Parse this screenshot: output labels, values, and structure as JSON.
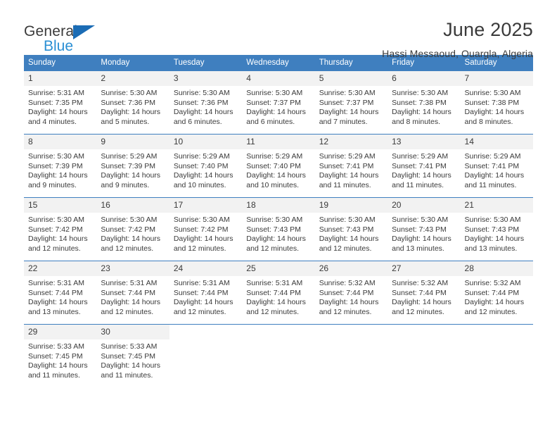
{
  "brand": {
    "line1": "General",
    "line2": "Blue",
    "triangle_color": "#1b6cb5",
    "line2_color": "#2a8fd4"
  },
  "header": {
    "title": "June 2025",
    "subtitle": "Hassi Messaoud, Ouargla, Algeria"
  },
  "colors": {
    "header_band": "#3f7fbf",
    "daynum_band": "#f2f2f2",
    "text": "#3a3a3a"
  },
  "weekdays": [
    "Sunday",
    "Monday",
    "Tuesday",
    "Wednesday",
    "Thursday",
    "Friday",
    "Saturday"
  ],
  "weeks": [
    [
      {
        "day": "1",
        "sunrise": "Sunrise: 5:31 AM",
        "sunset": "Sunset: 7:35 PM",
        "daylight": "Daylight: 14 hours and 4 minutes."
      },
      {
        "day": "2",
        "sunrise": "Sunrise: 5:30 AM",
        "sunset": "Sunset: 7:36 PM",
        "daylight": "Daylight: 14 hours and 5 minutes."
      },
      {
        "day": "3",
        "sunrise": "Sunrise: 5:30 AM",
        "sunset": "Sunset: 7:36 PM",
        "daylight": "Daylight: 14 hours and 6 minutes."
      },
      {
        "day": "4",
        "sunrise": "Sunrise: 5:30 AM",
        "sunset": "Sunset: 7:37 PM",
        "daylight": "Daylight: 14 hours and 6 minutes."
      },
      {
        "day": "5",
        "sunrise": "Sunrise: 5:30 AM",
        "sunset": "Sunset: 7:37 PM",
        "daylight": "Daylight: 14 hours and 7 minutes."
      },
      {
        "day": "6",
        "sunrise": "Sunrise: 5:30 AM",
        "sunset": "Sunset: 7:38 PM",
        "daylight": "Daylight: 14 hours and 8 minutes."
      },
      {
        "day": "7",
        "sunrise": "Sunrise: 5:30 AM",
        "sunset": "Sunset: 7:38 PM",
        "daylight": "Daylight: 14 hours and 8 minutes."
      }
    ],
    [
      {
        "day": "8",
        "sunrise": "Sunrise: 5:30 AM",
        "sunset": "Sunset: 7:39 PM",
        "daylight": "Daylight: 14 hours and 9 minutes."
      },
      {
        "day": "9",
        "sunrise": "Sunrise: 5:29 AM",
        "sunset": "Sunset: 7:39 PM",
        "daylight": "Daylight: 14 hours and 9 minutes."
      },
      {
        "day": "10",
        "sunrise": "Sunrise: 5:29 AM",
        "sunset": "Sunset: 7:40 PM",
        "daylight": "Daylight: 14 hours and 10 minutes."
      },
      {
        "day": "11",
        "sunrise": "Sunrise: 5:29 AM",
        "sunset": "Sunset: 7:40 PM",
        "daylight": "Daylight: 14 hours and 10 minutes."
      },
      {
        "day": "12",
        "sunrise": "Sunrise: 5:29 AM",
        "sunset": "Sunset: 7:41 PM",
        "daylight": "Daylight: 14 hours and 11 minutes."
      },
      {
        "day": "13",
        "sunrise": "Sunrise: 5:29 AM",
        "sunset": "Sunset: 7:41 PM",
        "daylight": "Daylight: 14 hours and 11 minutes."
      },
      {
        "day": "14",
        "sunrise": "Sunrise: 5:29 AM",
        "sunset": "Sunset: 7:41 PM",
        "daylight": "Daylight: 14 hours and 11 minutes."
      }
    ],
    [
      {
        "day": "15",
        "sunrise": "Sunrise: 5:30 AM",
        "sunset": "Sunset: 7:42 PM",
        "daylight": "Daylight: 14 hours and 12 minutes."
      },
      {
        "day": "16",
        "sunrise": "Sunrise: 5:30 AM",
        "sunset": "Sunset: 7:42 PM",
        "daylight": "Daylight: 14 hours and 12 minutes."
      },
      {
        "day": "17",
        "sunrise": "Sunrise: 5:30 AM",
        "sunset": "Sunset: 7:42 PM",
        "daylight": "Daylight: 14 hours and 12 minutes."
      },
      {
        "day": "18",
        "sunrise": "Sunrise: 5:30 AM",
        "sunset": "Sunset: 7:43 PM",
        "daylight": "Daylight: 14 hours and 12 minutes."
      },
      {
        "day": "19",
        "sunrise": "Sunrise: 5:30 AM",
        "sunset": "Sunset: 7:43 PM",
        "daylight": "Daylight: 14 hours and 12 minutes."
      },
      {
        "day": "20",
        "sunrise": "Sunrise: 5:30 AM",
        "sunset": "Sunset: 7:43 PM",
        "daylight": "Daylight: 14 hours and 13 minutes."
      },
      {
        "day": "21",
        "sunrise": "Sunrise: 5:30 AM",
        "sunset": "Sunset: 7:43 PM",
        "daylight": "Daylight: 14 hours and 13 minutes."
      }
    ],
    [
      {
        "day": "22",
        "sunrise": "Sunrise: 5:31 AM",
        "sunset": "Sunset: 7:44 PM",
        "daylight": "Daylight: 14 hours and 13 minutes."
      },
      {
        "day": "23",
        "sunrise": "Sunrise: 5:31 AM",
        "sunset": "Sunset: 7:44 PM",
        "daylight": "Daylight: 14 hours and 12 minutes."
      },
      {
        "day": "24",
        "sunrise": "Sunrise: 5:31 AM",
        "sunset": "Sunset: 7:44 PM",
        "daylight": "Daylight: 14 hours and 12 minutes."
      },
      {
        "day": "25",
        "sunrise": "Sunrise: 5:31 AM",
        "sunset": "Sunset: 7:44 PM",
        "daylight": "Daylight: 14 hours and 12 minutes."
      },
      {
        "day": "26",
        "sunrise": "Sunrise: 5:32 AM",
        "sunset": "Sunset: 7:44 PM",
        "daylight": "Daylight: 14 hours and 12 minutes."
      },
      {
        "day": "27",
        "sunrise": "Sunrise: 5:32 AM",
        "sunset": "Sunset: 7:44 PM",
        "daylight": "Daylight: 14 hours and 12 minutes."
      },
      {
        "day": "28",
        "sunrise": "Sunrise: 5:32 AM",
        "sunset": "Sunset: 7:44 PM",
        "daylight": "Daylight: 14 hours and 12 minutes."
      }
    ],
    [
      {
        "day": "29",
        "sunrise": "Sunrise: 5:33 AM",
        "sunset": "Sunset: 7:45 PM",
        "daylight": "Daylight: 14 hours and 11 minutes."
      },
      {
        "day": "30",
        "sunrise": "Sunrise: 5:33 AM",
        "sunset": "Sunset: 7:45 PM",
        "daylight": "Daylight: 14 hours and 11 minutes."
      },
      {
        "day": "",
        "sunrise": "",
        "sunset": "",
        "daylight": ""
      },
      {
        "day": "",
        "sunrise": "",
        "sunset": "",
        "daylight": ""
      },
      {
        "day": "",
        "sunrise": "",
        "sunset": "",
        "daylight": ""
      },
      {
        "day": "",
        "sunrise": "",
        "sunset": "",
        "daylight": ""
      },
      {
        "day": "",
        "sunrise": "",
        "sunset": "",
        "daylight": ""
      }
    ]
  ]
}
